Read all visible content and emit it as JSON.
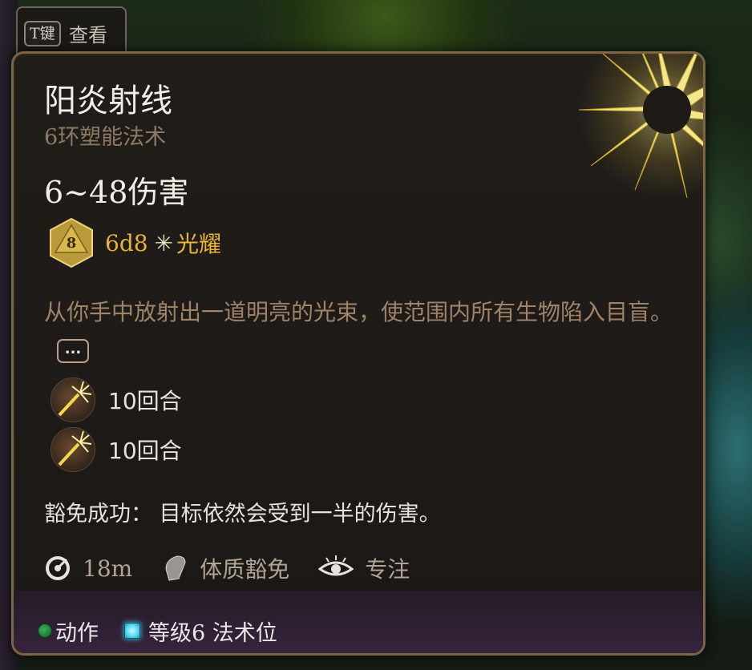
{
  "hint": {
    "key": "T键",
    "label": "查看"
  },
  "spell": {
    "title": "阳炎射线",
    "subtitle": "6环塑能法术",
    "damage": "6~48伤害",
    "die_face": "8",
    "dice": "6d8",
    "damage_type": "光耀",
    "description": "从你手中放射出一道明亮的光束，使范围内所有生物陷入目盲。",
    "more_label": "...",
    "statuses": [
      {
        "text": "10回合",
        "icon": "sunbeam-status-icon"
      },
      {
        "text": "10回合",
        "icon": "sunbeam-status-icon"
      }
    ],
    "save_note": "豁免成功：  目标依然会受到一半的伤害。",
    "range": "18m",
    "save_type": "体质豁免",
    "concentration": "专注"
  },
  "footer": {
    "action": "动作",
    "slot": "等级6 法术位"
  },
  "colors": {
    "accent_gold": "#e8b436",
    "border": "#7c6446",
    "description": "#a08468"
  }
}
